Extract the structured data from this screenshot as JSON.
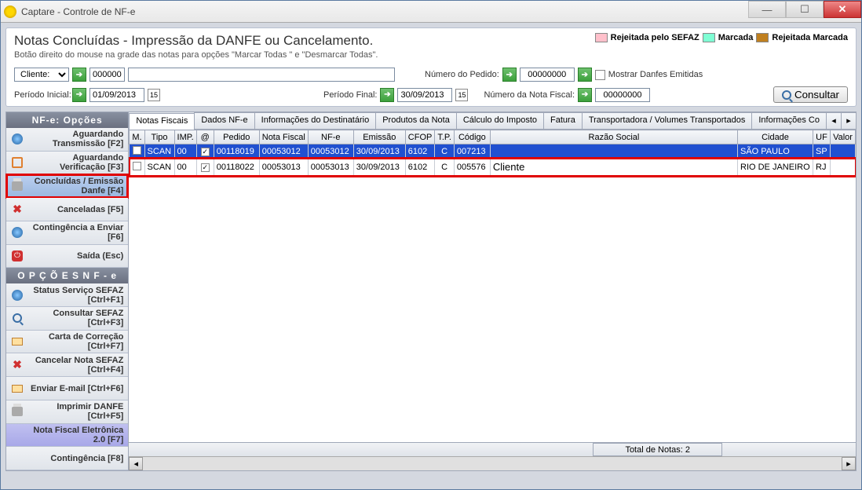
{
  "window": {
    "title": "Captare - Controle de  NF-e"
  },
  "header": {
    "title": "Notas Concluídas - Impressão da DANFE ou Cancelamento.",
    "subtitle": "Botão direito do mouse na grade das notas para opções \"Marcar Todas \" e \"Desmarcar Todas\".",
    "legend": {
      "rejected": "Rejeitada pelo SEFAZ",
      "marked": "Marcada",
      "rejected_marked": "Rejeitada Marcada"
    }
  },
  "filters": {
    "cliente_label": "Cliente:",
    "cliente_value": "000000",
    "pedido_label": "Número do Pedido:",
    "pedido_value": "00000000",
    "mostrar_label": "Mostrar Danfes Emitidas",
    "periodo_ini_label": "Período Inicial:",
    "periodo_ini_value": "01/09/2013",
    "periodo_fim_label": "Período Final:",
    "periodo_fim_value": "30/09/2013",
    "nota_label": "Número da Nota Fiscal:",
    "nota_value": "00000000",
    "consultar": "Consultar"
  },
  "sidebar": {
    "header1": "NF-e:  Opções",
    "items1": [
      "Aguardando Transmissão [F2]",
      "Aguardando Verificação [F3]",
      "Concluídas / Emissão Danfe [F4]",
      "Canceladas [F5]",
      "Contingência a Enviar [F6]",
      "Saída (Esc)"
    ],
    "header2": "O P Ç Õ E S    N F - e",
    "items2": [
      "Status Serviço SEFAZ [Ctrl+F1]",
      "Consultar SEFAZ [Ctrl+F3]",
      "Carta de Correção [Ctrl+F7]",
      "Cancelar Nota SEFAZ [Ctrl+F4]",
      "Enviar E-mail [Ctrl+F6]",
      "Imprimir DANFE [Ctrl+F5]",
      "Nota Fiscal Eletrônica 2.0 [F7]",
      "Contingência [F8]"
    ]
  },
  "tabs": [
    "Notas Fiscais",
    "Dados NF-e",
    "Informações do Destinatário",
    "Produtos da Nota",
    "Cálculo do Imposto",
    "Fatura",
    "Transportadora / Volumes Transportados",
    "Informações Co"
  ],
  "grid": {
    "headers": [
      "M.",
      "Tipo",
      "IMP.",
      "@",
      "Pedido",
      "Nota Fiscal",
      "NF-e",
      "Emissão",
      "CFOP",
      "T.P.",
      "Código",
      "Razão Social",
      "Cidade",
      "UF",
      "Valor"
    ],
    "rows": [
      {
        "m": false,
        "tipo": "SCAN",
        "imp": "00",
        "at": true,
        "pedido": "00118019",
        "nota": "00053012",
        "nfe": "00053012",
        "emissao": "30/09/2013",
        "cfop": "6102",
        "tp": "C",
        "codigo": "007213",
        "razao": "",
        "cidade": "SÃO PAULO",
        "uf": "SP",
        "valor": ""
      },
      {
        "m": false,
        "tipo": "SCAN",
        "imp": "00",
        "at": true,
        "pedido": "00118022",
        "nota": "00053013",
        "nfe": "00053013",
        "emissao": "30/09/2013",
        "cfop": "6102",
        "tp": "C",
        "codigo": "005576",
        "razao": "Cliente",
        "cidade": "RIO DE JANEIRO",
        "uf": "RJ",
        "valor": ""
      }
    ],
    "total": "Total de Notas: 2"
  }
}
